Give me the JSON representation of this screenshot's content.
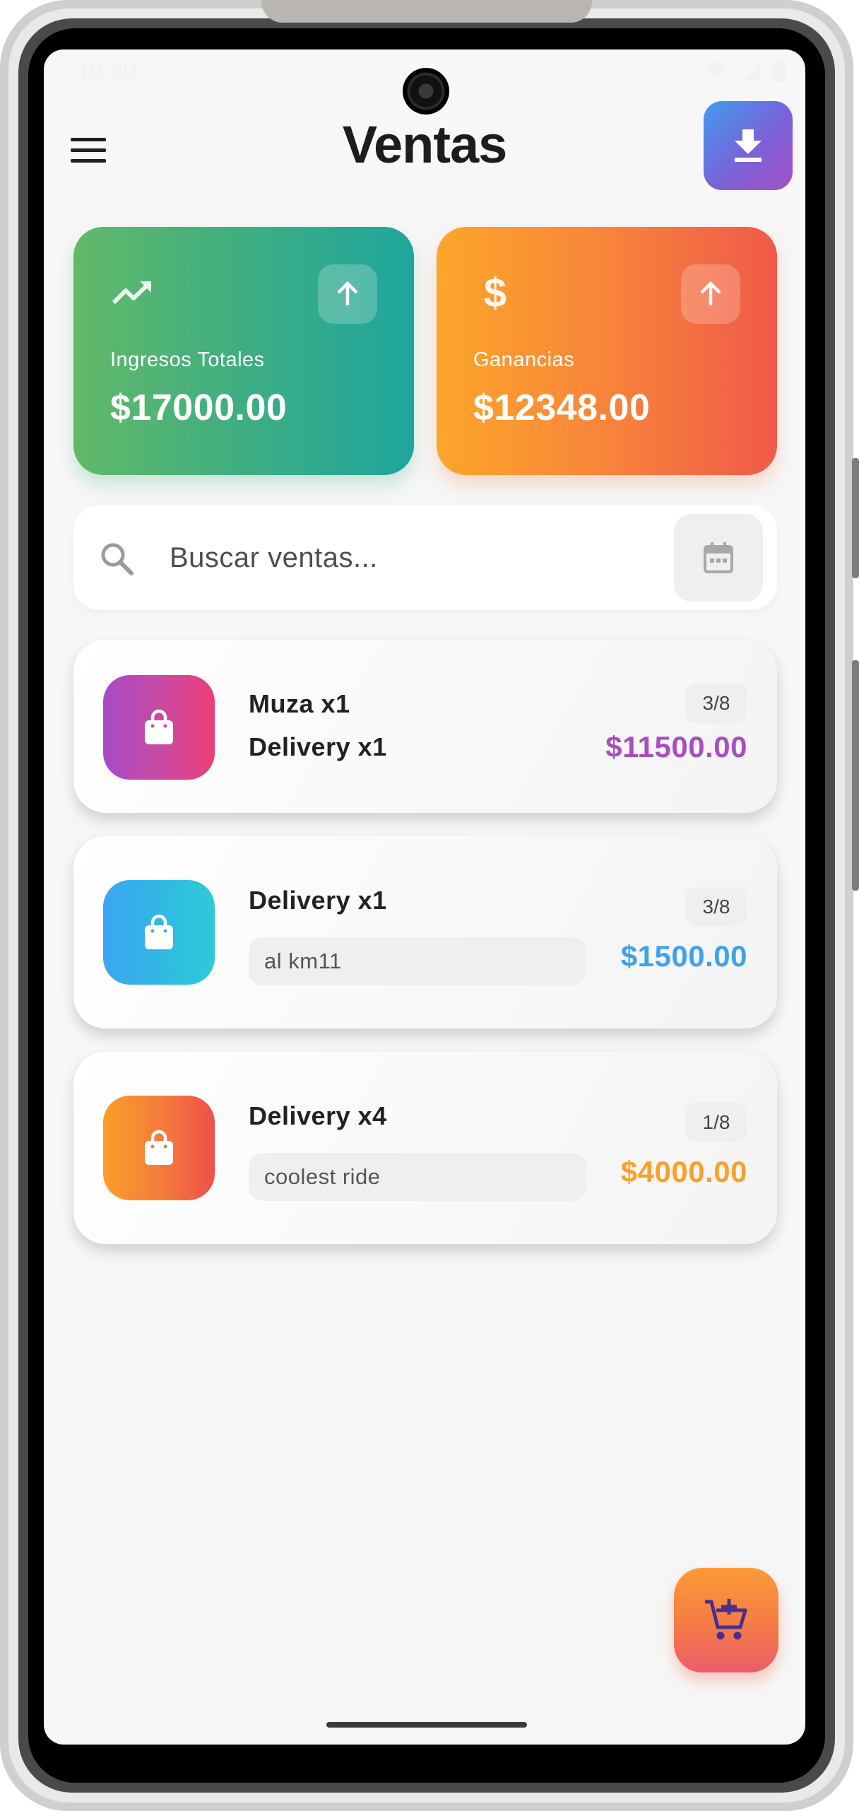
{
  "status_bar": {
    "time": "10:30"
  },
  "header": {
    "title": "Ventas"
  },
  "summary": {
    "total_income": {
      "label": "Ingresos Totales",
      "value": "$17000.00"
    },
    "profit": {
      "label": "Ganancias",
      "value": "$12348.00",
      "icon_glyph": "$"
    }
  },
  "search": {
    "placeholder": "Buscar ventas..."
  },
  "sales": [
    {
      "items": [
        "Muza x1",
        "Delivery x1"
      ],
      "note": "",
      "count": "3/8",
      "price": "$11500.00",
      "accent": "#a94ec2"
    },
    {
      "items": [
        "Delivery x1"
      ],
      "note": "al km11",
      "count": "3/8",
      "price": "$1500.00",
      "accent": "#3fa2ea"
    },
    {
      "items": [
        "Delivery x4"
      ],
      "note": "coolest ride",
      "count": "1/8",
      "price": "$4000.00",
      "accent": "#fba02a"
    }
  ],
  "icons": {
    "menu": "hamburger-icon",
    "download": "download-icon",
    "trend": "trending-up-icon",
    "dollar": "dollar-icon",
    "arrow_up": "arrow-up-icon",
    "search": "search-icon",
    "calendar": "calendar-icon",
    "bag": "shopping-bag-icon",
    "cart": "add-shopping-cart-icon"
  }
}
